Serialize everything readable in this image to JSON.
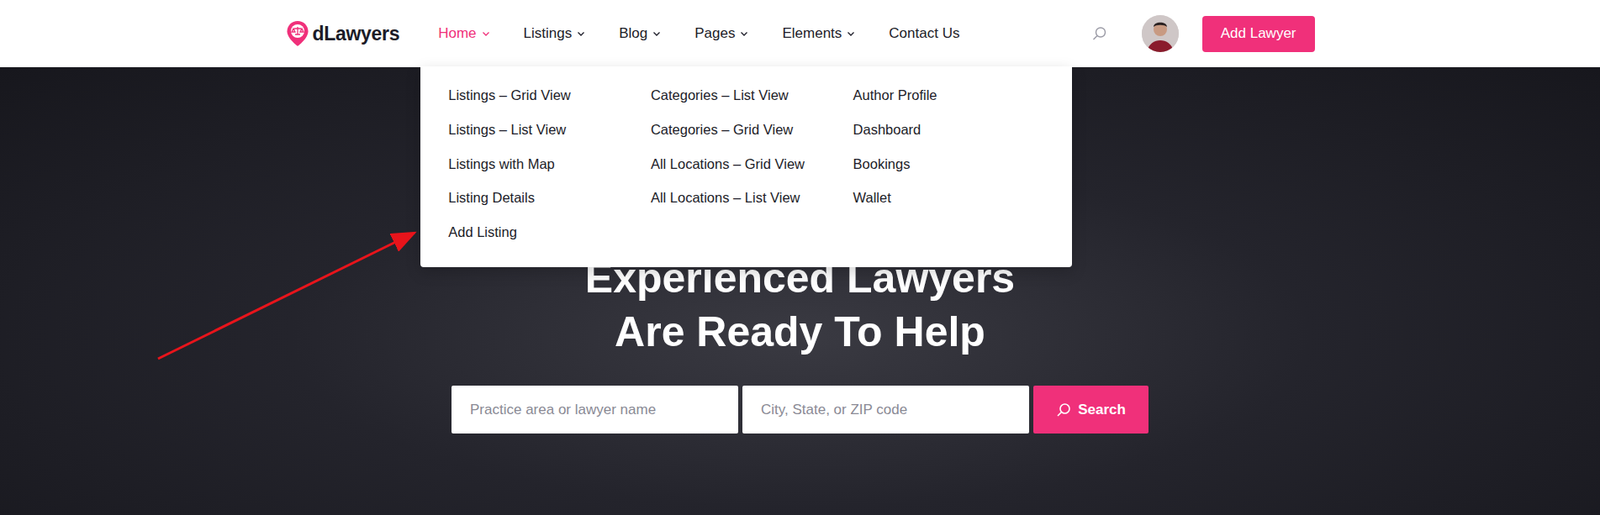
{
  "logo": {
    "text": "dLawyers"
  },
  "nav": [
    {
      "label": "Home",
      "selected": true,
      "dropdown": true,
      "expanded": true
    },
    {
      "label": "Listings",
      "selected": false,
      "dropdown": true,
      "expanded": false
    },
    {
      "label": "Blog",
      "selected": false,
      "dropdown": true,
      "expanded": false
    },
    {
      "label": "Pages",
      "selected": false,
      "dropdown": true,
      "expanded": false
    },
    {
      "label": "Elements",
      "selected": false,
      "dropdown": true,
      "expanded": false
    },
    {
      "label": "Contact Us",
      "selected": false,
      "dropdown": false,
      "expanded": false
    }
  ],
  "mega_menu": {
    "columns": [
      [
        "Listings – Grid View",
        "Listings – List View",
        "Listings with Map",
        "Listing Details",
        "Add Listing"
      ],
      [
        "Categories – List View",
        "Categories – Grid View",
        "All Locations – Grid View",
        "All Locations – List View"
      ],
      [
        "Author Profile",
        "Dashboard",
        "Bookings",
        "Wallet"
      ]
    ]
  },
  "header_button": "Add Lawyer",
  "hero": {
    "title_lines": [
      "Experienced Lawyers",
      "Are Ready To Help"
    ],
    "search": {
      "keyword_placeholder": "Practice area or lawyer name",
      "location_placeholder": "City, State, or ZIP code",
      "button": "Search"
    }
  }
}
